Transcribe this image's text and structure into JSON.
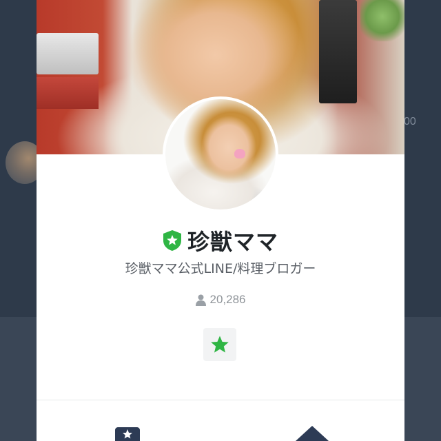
{
  "background": {
    "right_partial_text": "00"
  },
  "profile": {
    "name": "珍獣ママ",
    "status_message": "珍獣ママ公式LINE/料理ブロガー",
    "friends_count": "20,286",
    "verified_badge_icon": "shield-star-icon",
    "verified_badge_color": "#2fb544",
    "favorite_icon": "star-icon",
    "favorite_color": "#2fb544"
  },
  "actions": {
    "left_icon": "keep-icon",
    "right_icon": "home-icon"
  }
}
